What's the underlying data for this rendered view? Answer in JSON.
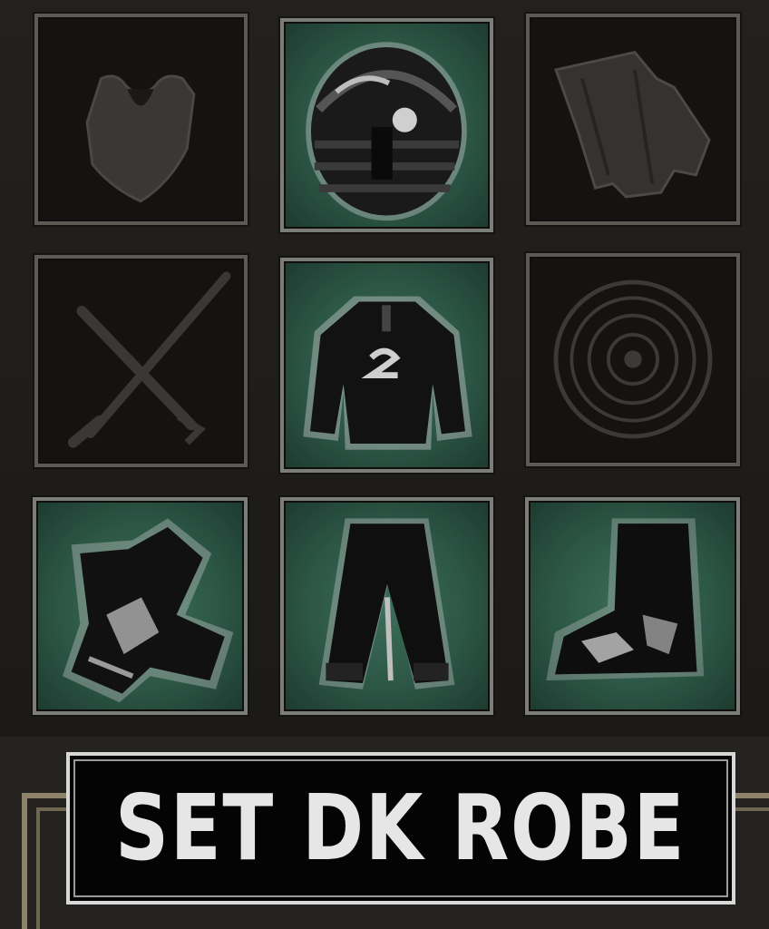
{
  "equipment_grid": {
    "slots": [
      {
        "slot": "armor",
        "state": "empty",
        "icon": "armor-silhouette-icon"
      },
      {
        "slot": "helm",
        "state": "equipped",
        "icon": "dark-helm-icon"
      },
      {
        "slot": "cape",
        "state": "empty",
        "icon": "cape-silhouette-icon"
      },
      {
        "slot": "weapons",
        "state": "empty",
        "icon": "crossed-weapons-silhouette-icon"
      },
      {
        "slot": "chest",
        "state": "equipped",
        "icon": "dark-robe-chest-icon"
      },
      {
        "slot": "shield",
        "state": "empty",
        "icon": "round-shield-silhouette-icon"
      },
      {
        "slot": "gloves",
        "state": "equipped",
        "icon": "dark-gloves-icon"
      },
      {
        "slot": "pants",
        "state": "equipped",
        "icon": "dark-pants-icon"
      },
      {
        "slot": "boots",
        "state": "equipped",
        "icon": "dark-boots-icon"
      }
    ],
    "equipped_bg_color": "#2c5646",
    "empty_bg_color": "#141312"
  },
  "set_label": {
    "text": "SET DK ROBE"
  }
}
